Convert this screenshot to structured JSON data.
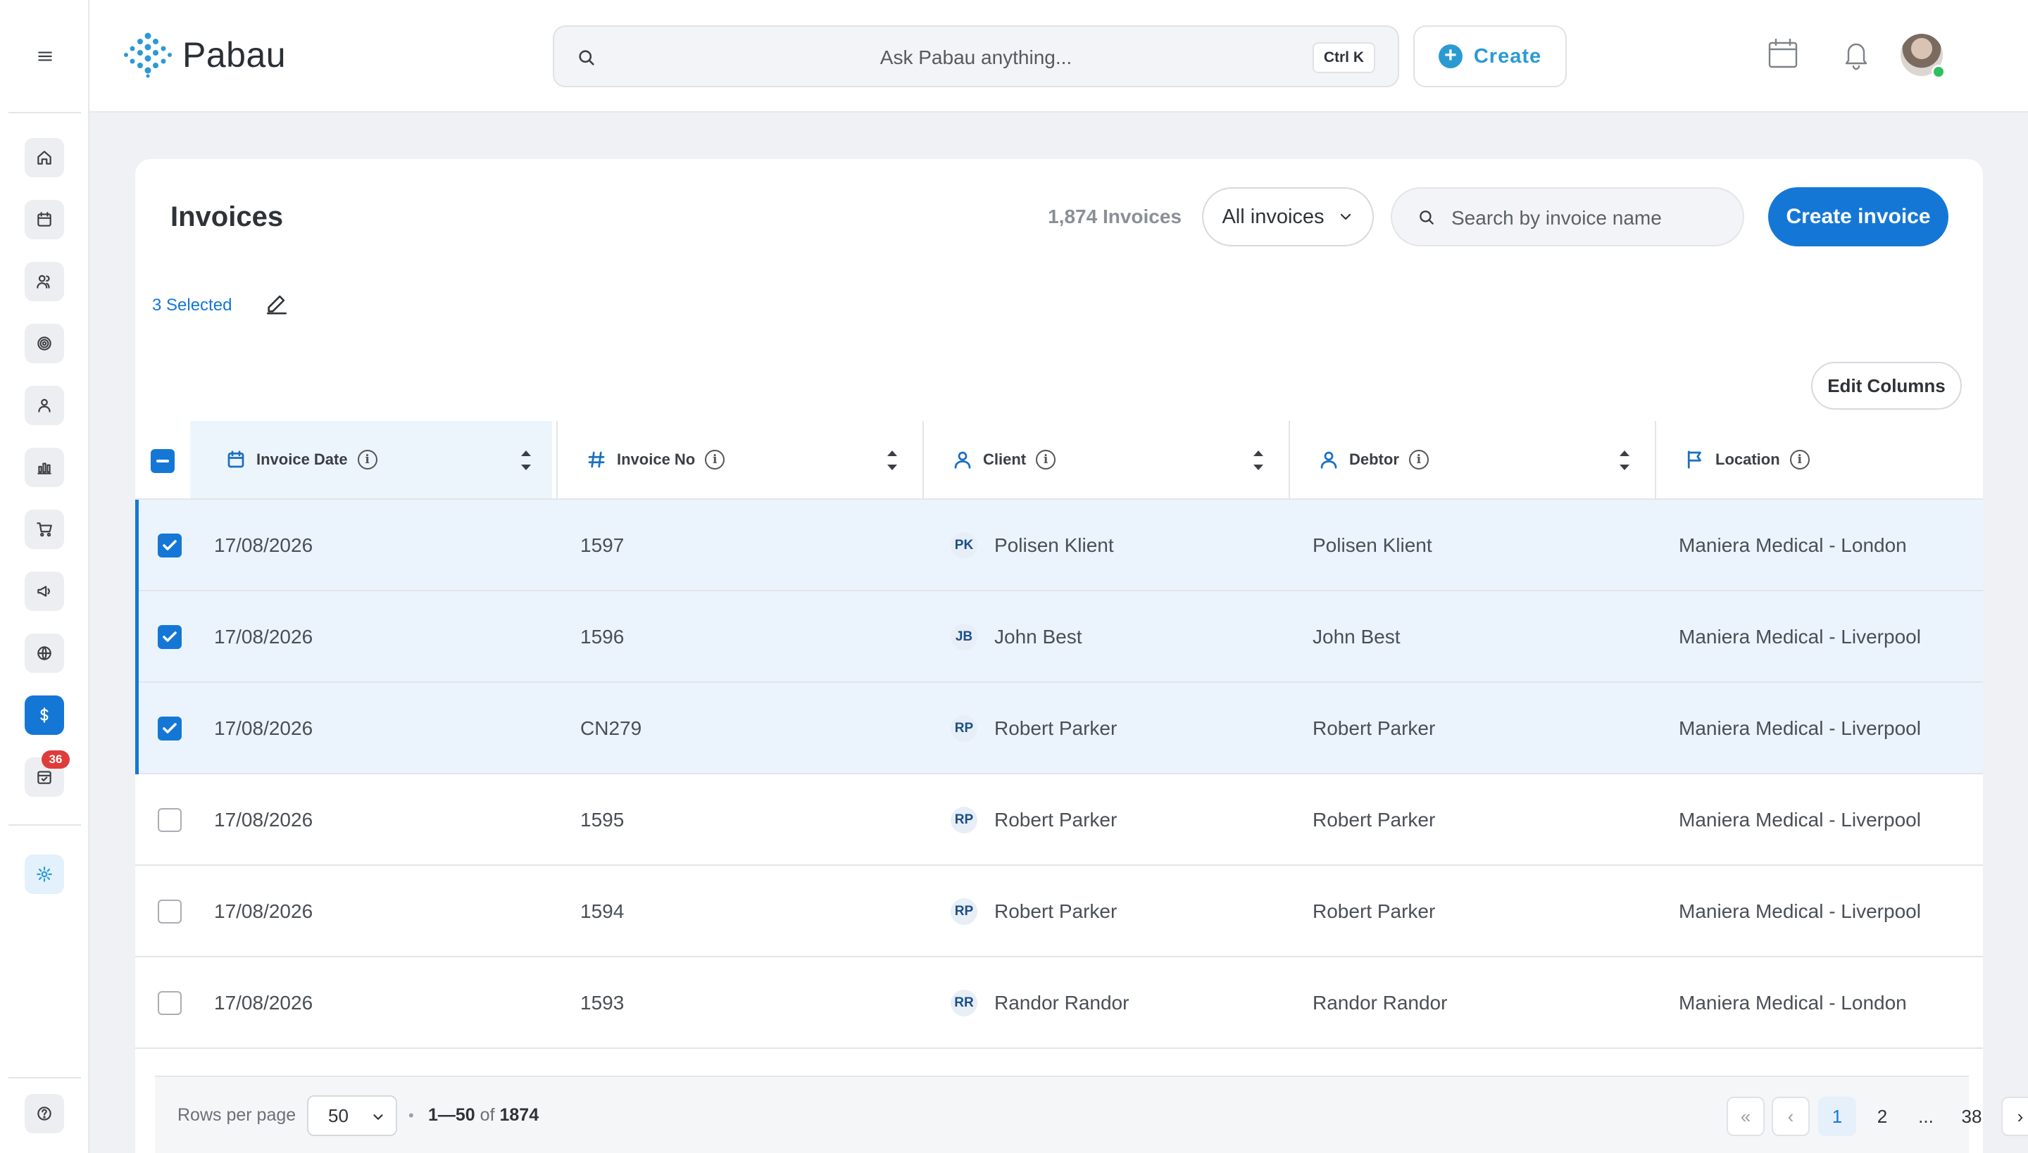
{
  "app": {
    "brand": "Pabau"
  },
  "topbar": {
    "ask_placeholder": "Ask Pabau anything...",
    "shortcut": "Ctrl K",
    "create_label": "Create"
  },
  "rail": {
    "badge_count": "36"
  },
  "page": {
    "title": "Invoices",
    "count_label": "1,874 Invoices",
    "filter_label": "All invoices",
    "search_placeholder": "Search by invoice name",
    "create_button": "Create invoice",
    "selected_label": "3 Selected",
    "edit_columns": "Edit Columns"
  },
  "table": {
    "columns": [
      "Invoice Date",
      "Invoice No",
      "Client",
      "Debtor",
      "Location"
    ],
    "rows": [
      {
        "selected": true,
        "date": "17/08/2026",
        "number": "1597",
        "initials": "PK",
        "client": "Polisen Klient",
        "debtor": "Polisen Klient",
        "location": "Maniera Medical - London"
      },
      {
        "selected": true,
        "date": "17/08/2026",
        "number": "1596",
        "initials": "JB",
        "client": "John Best",
        "debtor": "John Best",
        "location": "Maniera Medical - Liverpool"
      },
      {
        "selected": true,
        "date": "17/08/2026",
        "number": "CN279",
        "initials": "RP",
        "client": "Robert Parker",
        "debtor": "Robert Parker",
        "location": "Maniera Medical - Liverpool"
      },
      {
        "selected": false,
        "date": "17/08/2026",
        "number": "1595",
        "initials": "RP",
        "client": "Robert Parker",
        "debtor": "Robert Parker",
        "location": "Maniera Medical - Liverpool"
      },
      {
        "selected": false,
        "date": "17/08/2026",
        "number": "1594",
        "initials": "RP",
        "client": "Robert Parker",
        "debtor": "Robert Parker",
        "location": "Maniera Medical - Liverpool"
      },
      {
        "selected": false,
        "date": "17/08/2026",
        "number": "1593",
        "initials": "RR",
        "client": "Randor Randor",
        "debtor": "Randor Randor",
        "location": "Maniera Medical - London"
      }
    ]
  },
  "footer": {
    "rows_per_page_label": "Rows per page",
    "rows_per_page_value": "50",
    "range_start_end": "1—50",
    "range_of": "of",
    "range_total": "1874",
    "pages": [
      "1",
      "2",
      "...",
      "38"
    ],
    "current_page": "1",
    "first": "«",
    "prev": "‹",
    "next": "›",
    "last": "»"
  },
  "colors": {
    "accent": "#1477d6",
    "brand": "#2b9ad3",
    "badge": "#e03b3b",
    "selected_row": "#ebf4fc"
  },
  "icons": [
    "menu-icon",
    "home-icon",
    "calendar-icon",
    "users-icon",
    "target-icon",
    "person-icon",
    "chart-icon",
    "cart-icon",
    "megaphone-icon",
    "globe-icon",
    "dollar-icon",
    "calendar-check-icon",
    "sparkle-icon",
    "help-icon",
    "search-icon",
    "bell-icon",
    "chevron-down-icon",
    "pencil-icon",
    "hash-icon",
    "flag-icon",
    "info-icon",
    "sort-icon",
    "check-icon"
  ]
}
